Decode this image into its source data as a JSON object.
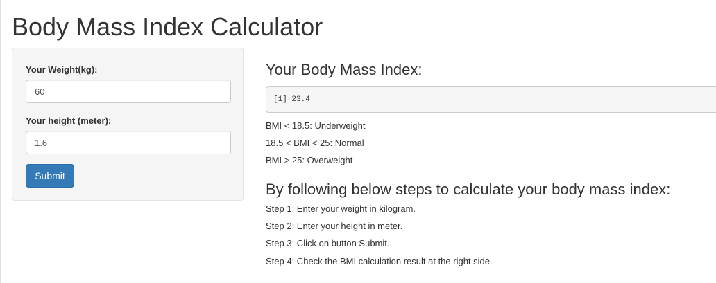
{
  "page": {
    "title": "Body Mass Index Calculator"
  },
  "sidebar": {
    "weight_label": "Your Weight(kg):",
    "weight_value": "60",
    "height_label": "Your height (meter):",
    "height_value": "1.6",
    "submit_label": "Submit"
  },
  "main": {
    "result_heading": "Your Body Mass Index:",
    "result_output": "[1] 23.4",
    "ranges": [
      "BMI < 18.5: Underweight",
      "18.5 < BMI < 25: Normal",
      "BMI > 25: Overweight"
    ],
    "steps_heading": "By following below steps to calculate your body mass index:",
    "steps": [
      "Step 1: Enter your weight in kilogram.",
      "Step 2: Enter your height in meter.",
      "Step 3: Click on button Submit.",
      "Step 4: Check the BMI calculation result at the right side."
    ]
  },
  "colors": {
    "primary_button": "#337ab7",
    "panel_background": "#f5f5f5"
  }
}
